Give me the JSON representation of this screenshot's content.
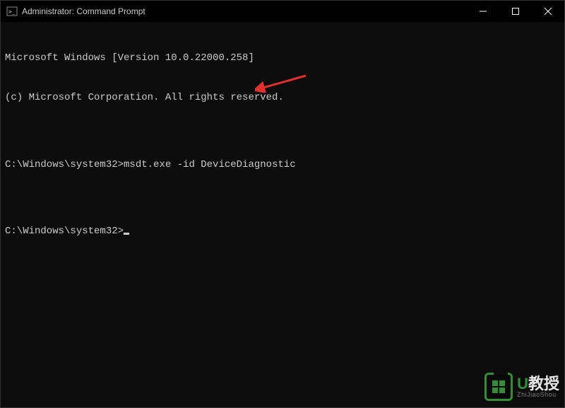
{
  "window": {
    "title": "Administrator: Command Prompt"
  },
  "terminal": {
    "line1": "Microsoft Windows [Version 10.0.22000.258]",
    "line2": "(c) Microsoft Corporation. All rights reserved.",
    "blank1": "",
    "prompt1_path": "C:\\Windows\\system32>",
    "prompt1_cmd": "msdt.exe -id DeviceDiagnostic",
    "blank2": "",
    "prompt2_path": "C:\\Windows\\system32>"
  },
  "watermark": {
    "u": "U",
    "text": "教授",
    "sub": "ZhiJiaoShou"
  }
}
